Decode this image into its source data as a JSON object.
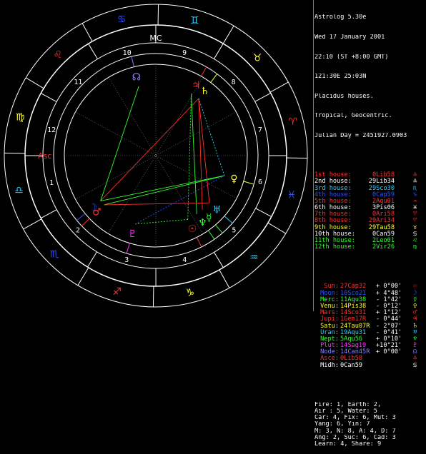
{
  "header": {
    "app": "Astrolog 5.30e",
    "date": "Wed 17 January 2001",
    "time": "22:10 (ST +8:00 GMT)",
    "location": "121:30E 25:03N",
    "houses": "Placidus houses.",
    "zodiac": "Tropical, Geocentric.",
    "julian": "Julian Day = 2451927.0903"
  },
  "house_cusps": [
    {
      "label": "1st house:",
      "value": "0Lib58",
      "color": "#ff3030",
      "glyph": "libra-glyph"
    },
    {
      "label": "2nd house:",
      "value": "29Lib34",
      "color": "#ffffff",
      "glyph": "libra-glyph"
    },
    {
      "label": "3rd house:",
      "value": "29Sco30",
      "color": "#30d0ff",
      "glyph": "scorpio-glyph"
    },
    {
      "label": "4th house:",
      "value": "0Cap59",
      "color": "#3050ff",
      "glyph": "capricorn-glyph"
    },
    {
      "label": "5th house:",
      "value": "2Aqu01",
      "color": "#ff3030",
      "glyph": "aquarius-glyph"
    },
    {
      "label": "6th house:",
      "value": "3Pis06",
      "color": "#ffffff",
      "glyph": "pisces-glyph"
    },
    {
      "label": "7th house:",
      "value": "0Ari58",
      "color": "#ff3030",
      "glyph": "aries-glyph"
    },
    {
      "label": "8th house:",
      "value": "29Ari34",
      "color": "#ff3030",
      "glyph": "aries-glyph"
    },
    {
      "label": "9th house:",
      "value": "29Tau58",
      "color": "#ffff30",
      "glyph": "taurus-glyph"
    },
    {
      "label": "10th house:",
      "value": "0Can59",
      "color": "#ffffff",
      "glyph": "cancer-glyph"
    },
    {
      "label": "11th house:",
      "value": "2Leo01",
      "color": "#30ff30",
      "glyph": "leo-glyph"
    },
    {
      "label": "12th house:",
      "value": "2Vir26",
      "color": "#30ff30",
      "glyph": "virgo-glyph"
    }
  ],
  "planets": [
    {
      "name": "Sun:",
      "pos": "27Cap32",
      "lat": "+ 0°00'",
      "color": "#ff3030",
      "glyph": "sun-glyph"
    },
    {
      "name": "Moon:",
      "pos": "10Sco21",
      "lat": "+ 4°48'",
      "color": "#3050ff",
      "glyph": "moon-glyph"
    },
    {
      "name": "Merc:",
      "pos": "11Aqu38",
      "lat": "- 1°42'",
      "color": "#30ff30",
      "glyph": "mercury-glyph"
    },
    {
      "name": "Venu:",
      "pos": "14Pis38",
      "lat": "- 0°12'",
      "color": "#ffff30",
      "glyph": "venus-glyph"
    },
    {
      "name": "Mars:",
      "pos": "14Sco31",
      "lat": "+ 1°12'",
      "color": "#ff3030",
      "glyph": "mars-glyph"
    },
    {
      "name": "Jupi:",
      "pos": "1Gem17R",
      "lat": "- 0°44'",
      "color": "#ff3030",
      "glyph": "jupiter-glyph"
    },
    {
      "name": "Satu:",
      "pos": "24Tau07R",
      "lat": "- 2°07'",
      "color": "#ffff30",
      "glyph": "saturn-glyph"
    },
    {
      "name": "Uran:",
      "pos": "19Aqu31",
      "lat": "- 0°41'",
      "color": "#30d0ff",
      "glyph": "uranus-glyph"
    },
    {
      "name": "Nept:",
      "pos": "5Aqu56",
      "lat": "+ 0°10'",
      "color": "#30ff30",
      "glyph": "neptune-glyph"
    },
    {
      "name": "Plut:",
      "pos": "14Sag19",
      "lat": "+10°21'",
      "color": "#ff30ff",
      "glyph": "pluto-glyph"
    },
    {
      "name": "Node:",
      "pos": "14Can45R",
      "lat": "+ 0°00'",
      "color": "#8080ff",
      "glyph": "node-glyph"
    },
    {
      "name": "Asce:",
      "pos": "0Lib58",
      "lat": "",
      "color": "#ff3030",
      "glyph": "libra-glyph"
    },
    {
      "name": "Midh:",
      "pos": "0Can59",
      "lat": "",
      "color": "#ffffff",
      "glyph": "mc-glyph"
    }
  ],
  "stats": [
    "Fire: 1, Earth: 2,",
    "Air : 5, Water: 5",
    "Car: 4, Fix: 6, Mut: 3",
    "Yang: 6, Yin: 7",
    "M: 3, N: 8, A: 4, D: 7",
    "Ang: 2, Suc: 6, Cad: 3",
    "Learn: 4, Share: 9"
  ],
  "wheel": {
    "house_numbers": [
      "1",
      "2",
      "3",
      "4",
      "5",
      "6",
      "7",
      "8",
      "9",
      "10",
      "11",
      "12"
    ],
    "sign_glyphs": [
      "♈",
      "♉",
      "♊",
      "♋",
      "♌",
      "♍",
      "♎",
      "♏",
      "♐",
      "♑",
      "♒",
      "♓"
    ],
    "angle_labels": {
      "asc": "Asc",
      "mc": "MC"
    },
    "colors": {
      "fire": "#ff3030",
      "earth": "#ffff30",
      "air": "#30d0ff",
      "water": "#3050ff",
      "ring": "#ffffff",
      "division": "#888888"
    }
  }
}
